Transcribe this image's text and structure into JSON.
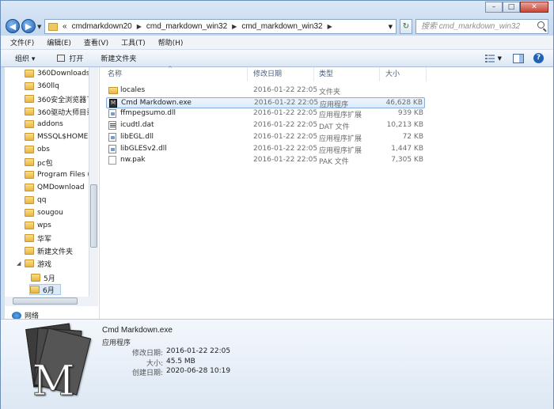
{
  "window": {
    "controls": [
      "–",
      "□",
      "✕"
    ]
  },
  "address": {
    "prefix": "«",
    "crumbs": [
      "cmdmarkdown20",
      "cmd_markdown_win32",
      "cmd_markdown_win32"
    ],
    "search_placeholder": "搜索 cmd_markdown_win32"
  },
  "menu": [
    "文件(F)",
    "编辑(E)",
    "查看(V)",
    "工具(T)",
    "帮助(H)"
  ],
  "toolbar": {
    "organize": "组织 ▾",
    "open": "打开",
    "new_folder": "新建文件夹"
  },
  "nav": {
    "items": [
      "360Downloads",
      "360llq",
      "360安全浏览器下",
      "360驱动大师目录",
      "addons",
      "MSSQL$HOME",
      "obs",
      "pc包",
      "Program Files (",
      "QMDownload",
      "qq",
      "sougou",
      "wps",
      "华军",
      "新建文件夹",
      "游戏",
      "5月",
      "6月"
    ],
    "network": "网络"
  },
  "columns": {
    "name": "名称",
    "modified": "修改日期",
    "type": "类型",
    "size": "大小"
  },
  "files": [
    {
      "name": "locales",
      "modified": "2016-01-22 22:05",
      "type": "文件夹",
      "size": "",
      "icon": "folder"
    },
    {
      "name": "Cmd Markdown.exe",
      "modified": "2016-01-22 22:05",
      "type": "应用程序",
      "size": "46,628 KB",
      "icon": "exe"
    },
    {
      "name": "ffmpegsumo.dll",
      "modified": "2016-01-22 22:05",
      "type": "应用程序扩展",
      "size": "939 KB",
      "icon": "dll"
    },
    {
      "name": "icudtl.dat",
      "modified": "2016-01-22 22:05",
      "type": "DAT 文件",
      "size": "10,213 KB",
      "icon": "dat"
    },
    {
      "name": "libEGL.dll",
      "modified": "2016-01-22 22:05",
      "type": "应用程序扩展",
      "size": "72 KB",
      "icon": "dll"
    },
    {
      "name": "libGLESv2.dll",
      "modified": "2016-01-22 22:05",
      "type": "应用程序扩展",
      "size": "1,447 KB",
      "icon": "dll"
    },
    {
      "name": "nw.pak",
      "modified": "2016-01-22 22:05",
      "type": "PAK 文件",
      "size": "7,305 KB",
      "icon": "pak"
    }
  ],
  "details": {
    "title": "Cmd Markdown.exe",
    "type": "应用程序",
    "modified_label": "修改日期:",
    "modified_value": "2016-01-22 22:05",
    "size_label": "大小:",
    "size_value": "45.5 MB",
    "created_label": "创建日期:",
    "created_value": "2020-06-28 10:19",
    "thumb_letter": "M"
  }
}
